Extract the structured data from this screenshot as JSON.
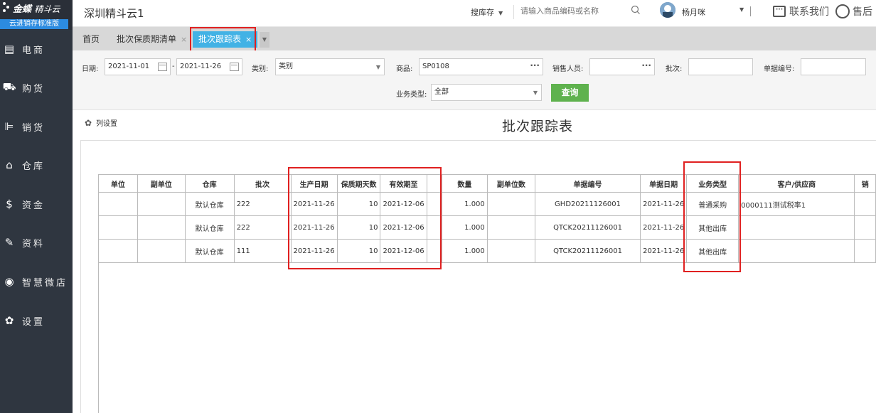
{
  "sidebar": {
    "logo": {
      "brand": "金蝶",
      "product": "精斗云"
    },
    "edition": "云进销存标准版",
    "items": [
      {
        "label": "电商",
        "icon": "store-icon"
      },
      {
        "label": "购货",
        "icon": "cart-icon"
      },
      {
        "label": "销货",
        "icon": "sales-icon"
      },
      {
        "label": "仓库",
        "icon": "warehouse-icon"
      },
      {
        "label": "资金",
        "icon": "money-icon"
      },
      {
        "label": "资料",
        "icon": "pen-icon"
      },
      {
        "label": "智慧微店",
        "icon": "microstore-icon"
      },
      {
        "label": "设置",
        "icon": "gear-icon"
      }
    ]
  },
  "header": {
    "company": "深圳精斗云1",
    "search_scope": "搜库存",
    "search_placeholder": "请输入商品编码或名称",
    "user_name": "杨月咪",
    "contact": "联系我们",
    "support": "售后"
  },
  "tabs": [
    {
      "label": "首页"
    },
    {
      "label": "批次保质期清单",
      "close": "×"
    },
    {
      "label": "批次跟踪表",
      "close": "×",
      "active": true
    }
  ],
  "filters": {
    "date_label": "日期:",
    "date_from": "2021-11-01",
    "date_sep": "-",
    "date_to": "2021-11-26",
    "category_label": "类别:",
    "category_value": "类别",
    "product_label": "商品:",
    "product_value": "SP0108",
    "salesperson_label": "销售人员:",
    "salesperson_value": "",
    "batch_label": "批次:",
    "batch_value": "",
    "doc_no_label": "单据编号:",
    "doc_no_value": "",
    "biz_type_label": "业务类型:",
    "biz_type_value": "全部",
    "query_button": "查询"
  },
  "report": {
    "column_settings": "列设置",
    "title": "批次跟踪表",
    "columns": [
      "单位",
      "副单位",
      "仓库",
      "批次",
      "生产日期",
      "保质期天数",
      "有效期至",
      "",
      "数量",
      "副单位数",
      "单据编号",
      "单据日期",
      "业务类型",
      "客户/供应商",
      "销"
    ],
    "rows": [
      [
        "",
        "",
        "默认仓库",
        "222",
        "2021-11-26",
        "10",
        "2021-12-06",
        "",
        "1.000",
        "",
        "GHD20211126001",
        "2021-11-26",
        "普通采购",
        "0000111测试税率1",
        ""
      ],
      [
        "",
        "",
        "默认仓库",
        "222",
        "2021-11-26",
        "10",
        "2021-12-06",
        "",
        "1.000",
        "",
        "QTCK20211126001",
        "2021-11-26",
        "其他出库",
        "",
        ""
      ],
      [
        "",
        "",
        "默认仓库",
        "111",
        "2021-11-26",
        "10",
        "2021-12-06",
        "",
        "1.000",
        "",
        "QTCK20211126001",
        "2021-11-26",
        "其他出库",
        "",
        ""
      ]
    ]
  },
  "colors": {
    "sidebar_bg": "#2f3640",
    "active_tab": "#42b2e5",
    "query_button": "#5fb24e",
    "highlight": "#e02020",
    "edition_badge": "#2c8be0"
  }
}
